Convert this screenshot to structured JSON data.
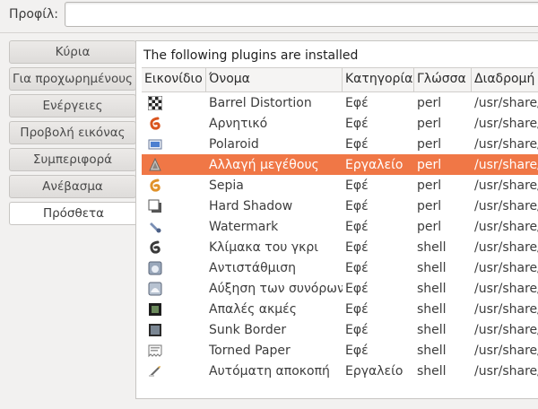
{
  "profile": {
    "label": "Προφίλ:",
    "value": ""
  },
  "tabs": [
    {
      "label": "Κύρια",
      "active": false
    },
    {
      "label": "Για προχωρημένους",
      "active": false
    },
    {
      "label": "Ενέργειες",
      "active": false
    },
    {
      "label": "Προβολή εικόνας",
      "active": false
    },
    {
      "label": "Συμπεριφορά",
      "active": false
    },
    {
      "label": "Ανέβασμα",
      "active": false
    },
    {
      "label": "Πρόσθετα",
      "active": true
    }
  ],
  "plugins": {
    "title": "The following plugins are installed",
    "columns": [
      "Εικονίδιο",
      "Όνομα",
      "Κατηγορία",
      "Γλώσσα",
      "Διαδρομή"
    ],
    "rows": [
      {
        "icon": "checkerboard-icon",
        "name": "Barrel Distortion",
        "category": "Εφέ",
        "language": "perl",
        "path": "/usr/share/"
      },
      {
        "icon": "negative-swirl-icon",
        "name": "Αρνητικό",
        "category": "Εφέ",
        "language": "perl",
        "path": "/usr/share/"
      },
      {
        "icon": "polaroid-icon",
        "name": "Polaroid",
        "category": "Εφέ",
        "language": "perl",
        "path": "/usr/share/"
      },
      {
        "icon": "resize-icon",
        "name": "Αλλαγή μεγέθους",
        "category": "Εργαλείο",
        "language": "perl",
        "path": "/usr/share/",
        "selected": true
      },
      {
        "icon": "sepia-swirl-icon",
        "name": "Sepia",
        "category": "Εφέ",
        "language": "perl",
        "path": "/usr/share/"
      },
      {
        "icon": "hard-shadow-icon",
        "name": "Hard Shadow",
        "category": "Εφέ",
        "language": "perl",
        "path": "/usr/share/"
      },
      {
        "icon": "watermark-icon",
        "name": "Watermark",
        "category": "Εφέ",
        "language": "perl",
        "path": "/usr/share/"
      },
      {
        "icon": "grayscale-swirl-icon",
        "name": "Κλίμακα του γκρι",
        "category": "Εφέ",
        "language": "shell",
        "path": "/usr/share/"
      },
      {
        "icon": "invert-icon",
        "name": "Αντιστάθμιση",
        "category": "Εφέ",
        "language": "shell",
        "path": "/usr/share/"
      },
      {
        "icon": "edge-boost-icon",
        "name": "Αύξηση των συνόρων",
        "category": "Εφέ",
        "language": "shell",
        "path": "/usr/share/"
      },
      {
        "icon": "soft-edges-icon",
        "name": "Απαλές ακμές",
        "category": "Εφέ",
        "language": "shell",
        "path": "/usr/share/"
      },
      {
        "icon": "sunk-border-icon",
        "name": "Sunk Border",
        "category": "Εφέ",
        "language": "shell",
        "path": "/usr/share/"
      },
      {
        "icon": "torned-paper-icon",
        "name": "Torned Paper",
        "category": "Εφέ",
        "language": "shell",
        "path": "/usr/share/"
      },
      {
        "icon": "autocrop-icon",
        "name": "Αυτόματη αποκοπή",
        "category": "Εργαλείο",
        "language": "shell",
        "path": "/usr/share/"
      }
    ]
  },
  "colors": {
    "selection": "#f07746",
    "panel_bg": "#ffffff",
    "window_bg": "#f2f1f0"
  }
}
